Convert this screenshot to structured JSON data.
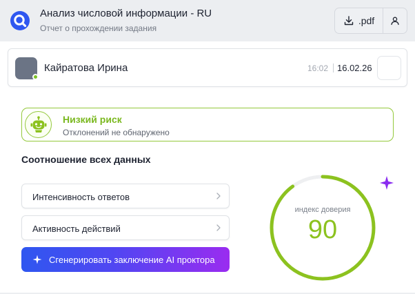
{
  "header": {
    "title": "Анализ числовой информации - RU",
    "subtitle": "Отчет о прохождении задания",
    "pdf_label": ".pdf",
    "logo_icon": "search-logo-icon",
    "download_icon": "download-icon",
    "user_icon": "user-icon"
  },
  "student": {
    "name": "Кайратова Ирина",
    "time": "16:02",
    "date": "16.02.26",
    "status_color": "#7cc227"
  },
  "risk": {
    "title": "Низкий риск",
    "subtitle": "Отклонений не обнаружено",
    "icon": "robot-icon",
    "color": "#93c83a"
  },
  "section": {
    "title": "Соотношение всех данных"
  },
  "metrics": [
    {
      "label": "Интенсивность ответов",
      "icon": "chevron-right-icon"
    },
    {
      "label": "Активность действий",
      "icon": "chevron-right-icon"
    }
  ],
  "ai_button": {
    "label": "Сгенерировать заключение AI проктора",
    "icon": "sparkle-icon"
  },
  "trust": {
    "label": "индекс доверия",
    "value": "90",
    "fraction": 0.9,
    "color": "#8cc21f",
    "track_color": "#eeeff1"
  },
  "colors": {
    "accent": "#2f57f0",
    "gradient_end": "#9a2cf0",
    "sparkle": "#8a2cf0"
  }
}
